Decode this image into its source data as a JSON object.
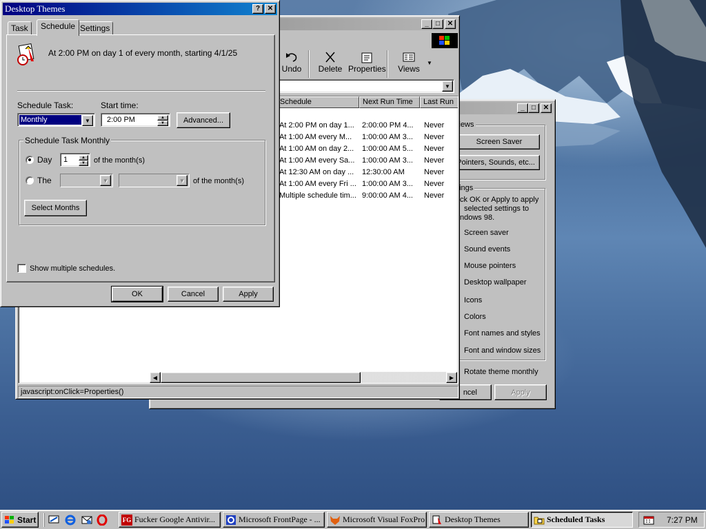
{
  "desktop_themes_dialog": {
    "title": "Desktop Themes",
    "help_button": "?",
    "close_button": "✕",
    "tabs": [
      "Task",
      "Schedule",
      "Settings"
    ],
    "schedule_summary": "At 2:00 PM on day 1 of every month, starting 4/1/25",
    "schedule_task_label": "Schedule Task:",
    "schedule_task_value": "Monthly",
    "start_time_label": "Start time:",
    "start_time_value": "2:00 PM",
    "advanced_button": "Advanced...",
    "monthly_group_label": "Schedule Task Monthly",
    "day_radio_label": "Day",
    "day_value": "1",
    "of_months_1": "of the month(s)",
    "the_radio_label": "The",
    "of_months_2": "of the month(s)",
    "select_months_button": "Select Months",
    "show_multiple_label": "Show multiple schedules.",
    "ok_button": "OK",
    "cancel_button": "Cancel",
    "apply_button": "Apply"
  },
  "scheduled_tasks_window": {
    "toolbar": {
      "undo": "Undo",
      "delete": "Delete",
      "properties": "Properties",
      "views": "Views"
    },
    "columns": [
      "Schedule",
      "Next Run Time",
      "Last Run"
    ],
    "rows": [
      [
        "At 2:00 PM on day 1...",
        "2:00:00 PM  4...",
        "Never"
      ],
      [
        "At 1:00 AM every M...",
        "1:00:00 AM  3...",
        "Never"
      ],
      [
        "At 1:00 AM on day 2...",
        "1:00:00 AM  5...",
        "Never"
      ],
      [
        "At 1:00 AM every Sa...",
        "1:00:00 AM  3...",
        "Never"
      ],
      [
        "At 12:30 AM on day ...",
        "12:30:00 AM",
        "Never"
      ],
      [
        "At 1:00 AM every Fri ...",
        "1:00:00 AM  3...",
        "Never"
      ],
      [
        "Multiple schedule tim...",
        "9:00:00 AM  4...",
        "Never"
      ]
    ],
    "status_text": "javascript:onClick=Properties()"
  },
  "desktop_themes_settings_window": {
    "previews_label": "views",
    "screen_saver_button": "Screen Saver",
    "pointers_button": "Pointers, Sounds, etc...",
    "settings_label": "ttings",
    "settings_desc_1": "ck OK or Apply to apply",
    "settings_desc_2": "selected settings to",
    "settings_desc_3": "ndows 98.",
    "options": [
      "Screen saver",
      "Sound events",
      "Mouse pointers",
      "Desktop wallpaper",
      "Icons",
      "Colors",
      "Font names and styles",
      "Font and window sizes"
    ],
    "rotate_label": "Rotate theme monthly",
    "cancel_button": "ncel",
    "apply_button": "Apply"
  },
  "taskbar": {
    "start_label": "Start",
    "tasks": [
      "Fucker Google Antivir...",
      "Microsoft FrontPage - ...",
      "Microsoft Visual FoxPro",
      "Desktop Themes",
      "Scheduled Tasks"
    ],
    "clock": "7:27 PM"
  }
}
